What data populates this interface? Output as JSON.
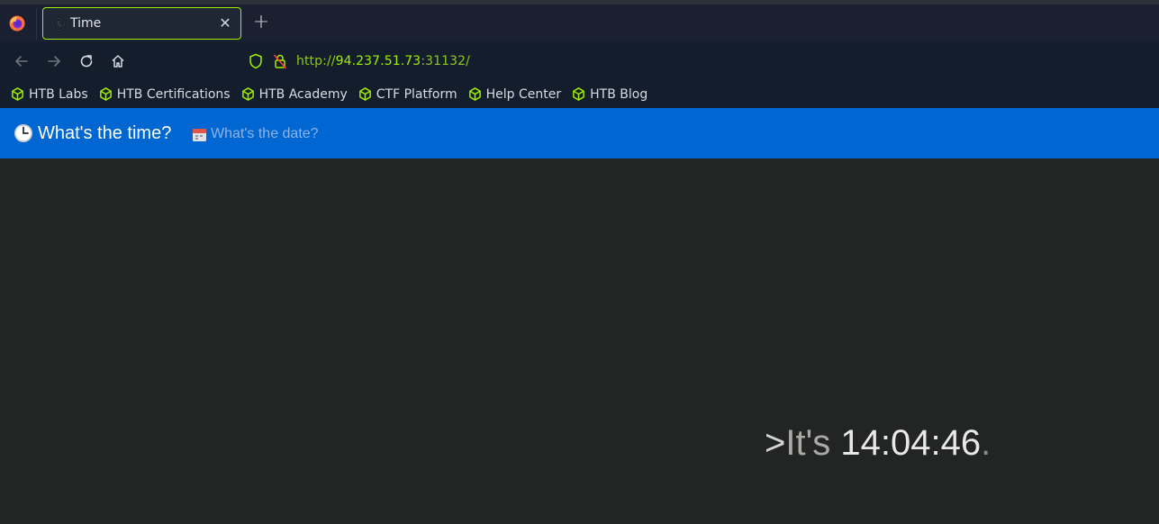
{
  "browser": {
    "tab": {
      "title": "Time",
      "close_glyph": "✕"
    },
    "new_tab_glyph": "+",
    "url": {
      "scheme": "http://",
      "host": "94.237.51.73",
      "port_path": ":31132/"
    },
    "bookmarks": [
      {
        "label": "HTB Labs",
        "icon": "htb-cube-icon"
      },
      {
        "label": "HTB Certifications",
        "icon": "htb-cube-icon"
      },
      {
        "label": "HTB Academy",
        "icon": "htb-cube-icon"
      },
      {
        "label": "CTF Platform",
        "icon": "htb-cube-icon"
      },
      {
        "label": "Help Center",
        "icon": "htb-cube-icon"
      },
      {
        "label": "HTB Blog",
        "icon": "htb-cube-icon"
      }
    ],
    "accent_color": "#9fef00"
  },
  "page": {
    "nav": {
      "brand": "What's the time?",
      "brand_icon": "clock-emoji-icon",
      "date_link": "What's the date?",
      "date_icon": "calendar-emoji-icon",
      "bg_color": "#0066d2"
    },
    "message": {
      "prefix": ">",
      "its": "It's",
      "time": "14:04:46",
      "suffix": "."
    }
  }
}
